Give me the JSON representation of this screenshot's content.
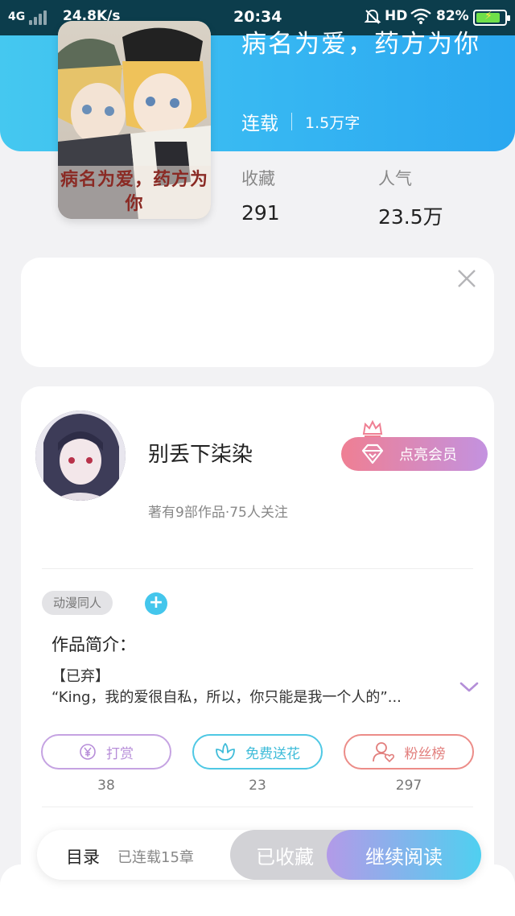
{
  "status_bar": {
    "network": "4G",
    "speed": "24.8K/s",
    "time": "20:34",
    "hd": "HD",
    "battery": "82%"
  },
  "book": {
    "title": "病名为爱，药方为你",
    "cover_text": "病名为爱，药方为你",
    "status": "连载",
    "word_count": "1.5万字",
    "favorites_label": "收藏",
    "favorites_value": "291",
    "popularity_label": "人气",
    "popularity_value": "23.5万"
  },
  "author": {
    "name": "别丢下柒染",
    "stats": "著有9部作品·75人关注",
    "vip_button": "点亮会员"
  },
  "tags": [
    "动漫同人"
  ],
  "intro": {
    "heading": "作品简介：",
    "line1": "【已弃】",
    "line2": "“King，我的爱很自私，所以，你只能是我一个人的”..."
  },
  "actions": [
    {
      "label": "打赏",
      "count": "38"
    },
    {
      "label": "免费送花",
      "count": "23"
    },
    {
      "label": "粉丝榜",
      "count": "297"
    }
  ],
  "bottom_bar": {
    "toc_label": "目录",
    "toc_count": "已连载15章",
    "collected_button": "已收藏",
    "read_button": "继续阅读"
  },
  "colors": {
    "header_blue": "#36b6f2",
    "vip_pink": "#ef7f93",
    "vip_purple": "#c392e0",
    "reward_purple": "#b78ed9",
    "flower_cyan": "#3fbcd9",
    "fans_red": "#e27f7d",
    "read_gradient_start": "#b39ae8",
    "read_gradient_end": "#4fd0f0"
  }
}
